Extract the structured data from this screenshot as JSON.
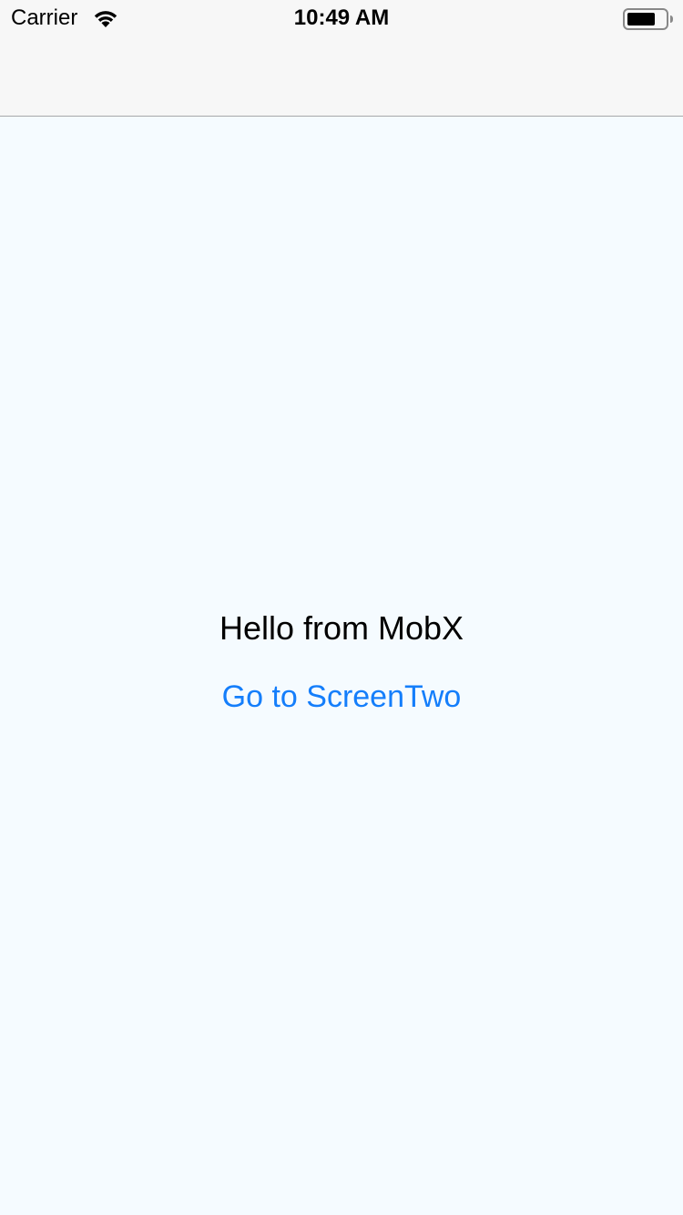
{
  "status_bar": {
    "carrier": "Carrier",
    "time": "10:49 AM",
    "wifi_icon": "wifi-icon",
    "battery_icon": "battery-icon"
  },
  "main": {
    "greeting": "Hello from MobX",
    "link_label": "Go to ScreenTwo"
  },
  "colors": {
    "background": "#F5FBFF",
    "nav_background": "#F7F7F7",
    "link": "#147EFB",
    "text": "#000000"
  }
}
